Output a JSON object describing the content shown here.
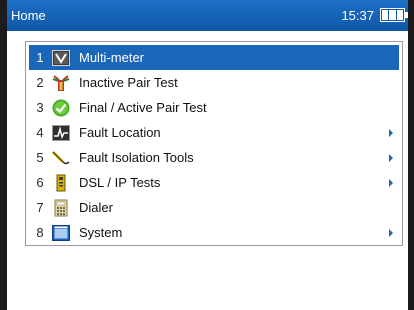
{
  "titlebar": {
    "title": "Home",
    "time": "15:37"
  },
  "menu": {
    "items": [
      {
        "num": "1",
        "label": "Multi-meter",
        "icon": "multimeter-icon",
        "selected": true,
        "submenu": false
      },
      {
        "num": "2",
        "label": "Inactive Pair Test",
        "icon": "pair-test-icon",
        "selected": false,
        "submenu": false
      },
      {
        "num": "3",
        "label": "Final / Active Pair Test",
        "icon": "check-circle-icon",
        "selected": false,
        "submenu": false
      },
      {
        "num": "4",
        "label": "Fault Location",
        "icon": "waveform-icon",
        "selected": false,
        "submenu": true
      },
      {
        "num": "5",
        "label": "Fault Isolation Tools",
        "icon": "probe-icon",
        "selected": false,
        "submenu": true
      },
      {
        "num": "6",
        "label": "DSL / IP Tests",
        "icon": "dsl-modem-icon",
        "selected": false,
        "submenu": true
      },
      {
        "num": "7",
        "label": "Dialer",
        "icon": "keypad-icon",
        "selected": false,
        "submenu": false
      },
      {
        "num": "8",
        "label": "System",
        "icon": "system-window-icon",
        "selected": false,
        "submenu": true
      }
    ]
  },
  "colors": {
    "titlebar": "#1668bd",
    "selection": "#1a66b8",
    "submenu_arrow": "#1a66b8"
  }
}
